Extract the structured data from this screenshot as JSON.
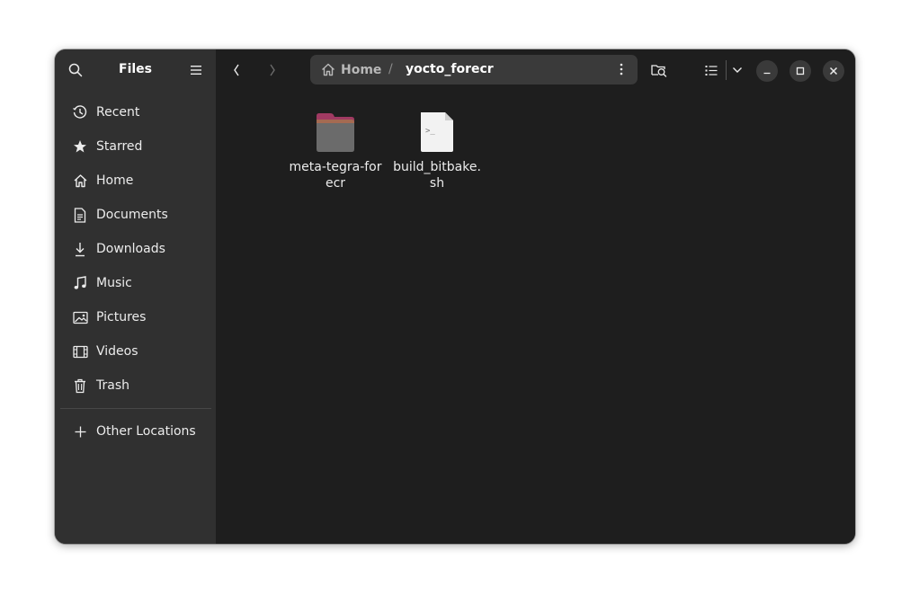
{
  "app": {
    "title": "Files"
  },
  "sidebar": {
    "places": [
      {
        "label": "Recent",
        "icon": "clock-icon"
      },
      {
        "label": "Starred",
        "icon": "star-icon"
      },
      {
        "label": "Home",
        "icon": "home-icon"
      },
      {
        "label": "Documents",
        "icon": "document-icon"
      },
      {
        "label": "Downloads",
        "icon": "download-icon"
      },
      {
        "label": "Music",
        "icon": "music-icon"
      },
      {
        "label": "Pictures",
        "icon": "picture-icon"
      },
      {
        "label": "Videos",
        "icon": "video-icon"
      },
      {
        "label": "Trash",
        "icon": "trash-icon"
      }
    ],
    "other_locations": {
      "label": "Other Locations",
      "icon": "plus-icon"
    }
  },
  "pathbar": {
    "home_label": "Home",
    "separator": "/",
    "current": "yocto_forecr"
  },
  "files": [
    {
      "name": "meta-tegra-forecr",
      "type": "folder",
      "icon": "folder-icon"
    },
    {
      "name": "build_bitbake.sh",
      "type": "script",
      "icon": "shell-script-icon"
    }
  ],
  "colors": {
    "window_bg": "#1e1e1e",
    "sidebar_bg": "#303030",
    "pathbar_bg": "#3a3a3a",
    "folder_tab": "#a03a62",
    "folder_body": "#6b6b6b"
  }
}
